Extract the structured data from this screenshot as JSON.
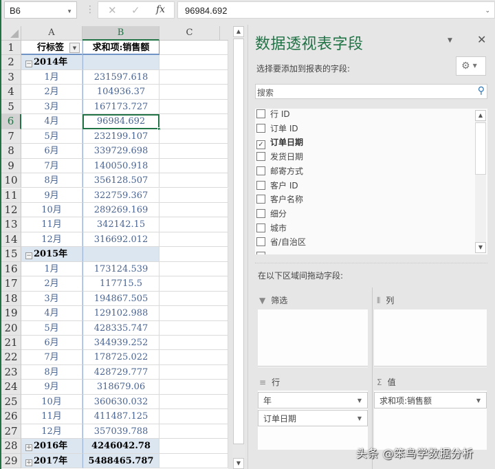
{
  "formula_bar": {
    "name_box": "B6",
    "cancel_icon": "✕",
    "enter_icon": "✓",
    "fx_label": "fx",
    "value": "96984.692"
  },
  "grid": {
    "columns": [
      "A",
      "B",
      "C"
    ],
    "selected_column": "B",
    "selected_row": 6,
    "header_row": {
      "row": 1,
      "a": "行标签",
      "b": "求和项:销售额"
    },
    "rows": [
      {
        "n": "2",
        "type": "year",
        "toggle": "−",
        "a": "2014年",
        "b": ""
      },
      {
        "n": "3",
        "type": "month",
        "a": "1月",
        "b": "231597.618"
      },
      {
        "n": "4",
        "type": "month",
        "a": "2月",
        "b": "104936.37"
      },
      {
        "n": "5",
        "type": "month",
        "a": "3月",
        "b": "167173.727"
      },
      {
        "n": "6",
        "type": "month",
        "a": "4月",
        "b": "96984.692"
      },
      {
        "n": "7",
        "type": "month",
        "a": "5月",
        "b": "232199.107"
      },
      {
        "n": "8",
        "type": "month",
        "a": "6月",
        "b": "339729.698"
      },
      {
        "n": "9",
        "type": "month",
        "a": "7月",
        "b": "140050.918"
      },
      {
        "n": "10",
        "type": "month",
        "a": "8月",
        "b": "356128.507"
      },
      {
        "n": "11",
        "type": "month",
        "a": "9月",
        "b": "322759.367"
      },
      {
        "n": "12",
        "type": "month",
        "a": "10月",
        "b": "289269.169"
      },
      {
        "n": "13",
        "type": "month",
        "a": "11月",
        "b": "342142.15"
      },
      {
        "n": "14",
        "type": "month",
        "a": "12月",
        "b": "316692.012"
      },
      {
        "n": "15",
        "type": "year",
        "toggle": "−",
        "a": "2015年",
        "b": ""
      },
      {
        "n": "16",
        "type": "month",
        "a": "1月",
        "b": "173124.539"
      },
      {
        "n": "17",
        "type": "month",
        "a": "2月",
        "b": "117715.5"
      },
      {
        "n": "18",
        "type": "month",
        "a": "3月",
        "b": "194867.505"
      },
      {
        "n": "19",
        "type": "month",
        "a": "4月",
        "b": "129102.988"
      },
      {
        "n": "20",
        "type": "month",
        "a": "5月",
        "b": "428335.747"
      },
      {
        "n": "21",
        "type": "month",
        "a": "6月",
        "b": "344939.252"
      },
      {
        "n": "22",
        "type": "month",
        "a": "7月",
        "b": "178725.022"
      },
      {
        "n": "23",
        "type": "month",
        "a": "8月",
        "b": "428729.777"
      },
      {
        "n": "24",
        "type": "month",
        "a": "9月",
        "b": "318679.06"
      },
      {
        "n": "25",
        "type": "month",
        "a": "10月",
        "b": "360630.032"
      },
      {
        "n": "26",
        "type": "month",
        "a": "11月",
        "b": "411487.125"
      },
      {
        "n": "27",
        "type": "month",
        "a": "12月",
        "b": "357039.788"
      },
      {
        "n": "28",
        "type": "year",
        "toggle": "+",
        "a": "2016年",
        "b": "4246042.78"
      },
      {
        "n": "29",
        "type": "year",
        "toggle": "+",
        "a": "2017年",
        "b": "5488465.787"
      }
    ]
  },
  "pivot_pane": {
    "title": "数据透视表字段",
    "subtitle": "选择要添加到报表的字段:",
    "search_placeholder": "搜索",
    "fields": [
      {
        "label": "行 ID",
        "checked": false
      },
      {
        "label": "订单 ID",
        "checked": false
      },
      {
        "label": "订单日期",
        "checked": true
      },
      {
        "label": "发货日期",
        "checked": false
      },
      {
        "label": "邮寄方式",
        "checked": false
      },
      {
        "label": "客户 ID",
        "checked": false
      },
      {
        "label": "客户名称",
        "checked": false
      },
      {
        "label": "细分",
        "checked": false
      },
      {
        "label": "城市",
        "checked": false
      },
      {
        "label": "省/自治区",
        "checked": false
      }
    ],
    "drag_label": "在以下区域间拖动字段:",
    "areas": {
      "filter": {
        "label": "筛选",
        "items": []
      },
      "columns": {
        "label": "列",
        "items": []
      },
      "rows": {
        "label": "行",
        "items": [
          "年",
          "订单日期"
        ]
      },
      "values": {
        "label": "值",
        "items": [
          "求和项:销售额"
        ]
      }
    }
  },
  "watermark": "头条 @笨鸟学数据分析"
}
